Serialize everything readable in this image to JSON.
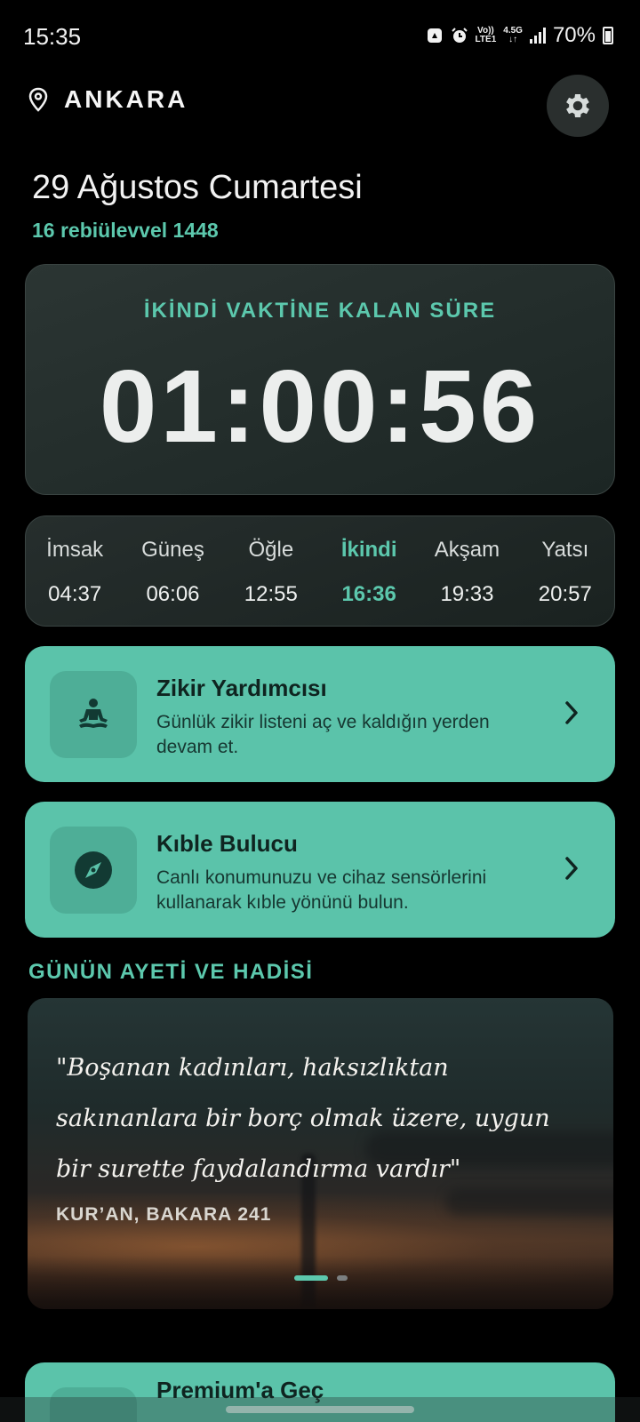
{
  "status_bar": {
    "time": "15:35",
    "net_volte": "Vo))",
    "net_lte": "LTE1",
    "net_speed": "4.5G",
    "battery": "70%"
  },
  "header": {
    "location": "ANKARA",
    "settings_icon": "gear-icon",
    "location_icon": "location-pin-icon"
  },
  "date": {
    "gregorian": "29 Ağustos Cumartesi",
    "hijri": "16 rebiülevvel 1448"
  },
  "countdown": {
    "label": "İKİNDİ VAKTİNE KALAN SÜRE",
    "value": "01:00:56"
  },
  "prayer_times": [
    {
      "name": "İmsak",
      "time": "04:37",
      "active": false
    },
    {
      "name": "Güneş",
      "time": "06:06",
      "active": false
    },
    {
      "name": "Öğle",
      "time": "12:55",
      "active": false
    },
    {
      "name": "İkindi",
      "time": "16:36",
      "active": true
    },
    {
      "name": "Akşam",
      "time": "19:33",
      "active": false
    },
    {
      "name": "Yatsı",
      "time": "20:57",
      "active": false
    }
  ],
  "cards": {
    "zikir": {
      "title": "Zikir Yardımcısı",
      "desc": "Günlük zikir listeni aç ve kaldığın yerden devam et.",
      "icon": "meditation-icon"
    },
    "kible": {
      "title": "Kıble Bulucu",
      "desc": "Canlı konumunuzu ve cihaz sensörlerini kullanarak kıble yönünü bulun.",
      "icon": "compass-icon"
    },
    "premium": {
      "title": "Premium'a Geç"
    }
  },
  "daily": {
    "section_title": "GÜNÜN AYETİ VE HADİSİ",
    "quote": "\"Boşanan kadınları, haksızlıktan sakınanlara bir borç olmak üzere, uygun bir surette faydalandırma vardır\"",
    "source": "KUR’AN, BAKARA 241",
    "page_count": 2,
    "active_page": 1
  },
  "colors": {
    "accent": "#5cc8ad",
    "card": "#5bc3aa",
    "background": "#000000"
  }
}
